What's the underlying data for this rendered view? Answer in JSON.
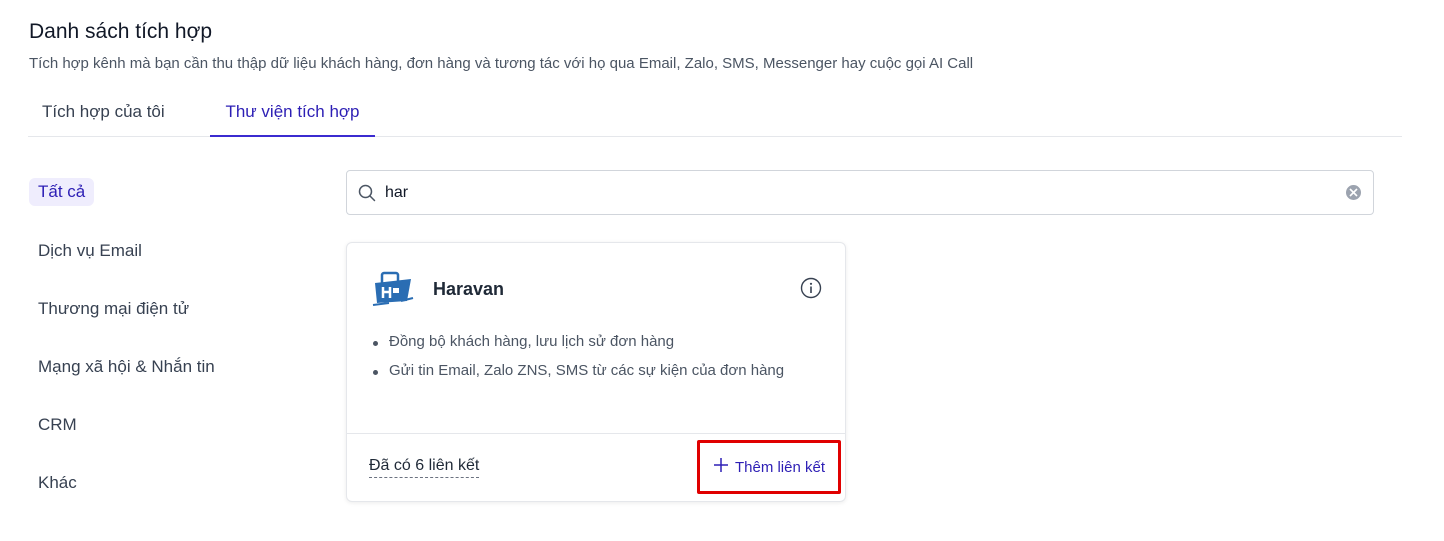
{
  "header": {
    "title": "Danh sách tích hợp",
    "subtitle": "Tích hợp kênh mà bạn cần thu thập dữ liệu khách hàng, đơn hàng và tương tác với họ qua Email, Zalo, SMS, Messenger hay cuộc gọi AI Call"
  },
  "tabs": [
    {
      "label": "Tích hợp của tôi",
      "active": false
    },
    {
      "label": "Thư viện tích hợp",
      "active": true
    }
  ],
  "categories": [
    {
      "label": "Tất cả",
      "active": true
    },
    {
      "label": "Dịch vụ Email",
      "active": false
    },
    {
      "label": "Thương mại điện tử",
      "active": false
    },
    {
      "label": "Mạng xã hội & Nhắn tin",
      "active": false
    },
    {
      "label": "CRM",
      "active": false
    },
    {
      "label": "Khác",
      "active": false
    }
  ],
  "search": {
    "value": "har",
    "icon": "search-icon",
    "clear_icon": "clear-icon"
  },
  "integration_card": {
    "name": "Haravan",
    "logo": "haravan-logo",
    "features": [
      "Đồng bộ khách hàng, lưu lịch sử đơn hàng",
      "Gửi tin Email, Zalo ZNS, SMS từ các sự kiện của đơn hàng"
    ],
    "linked_count_label": "Đã có 6 liên kết",
    "add_link_label": "Thêm liên kết"
  },
  "colors": {
    "accent": "#2d1fb5",
    "active_bg": "#efedfd",
    "highlight_border": "#e00000",
    "logo_blue": "#2a6db3"
  }
}
